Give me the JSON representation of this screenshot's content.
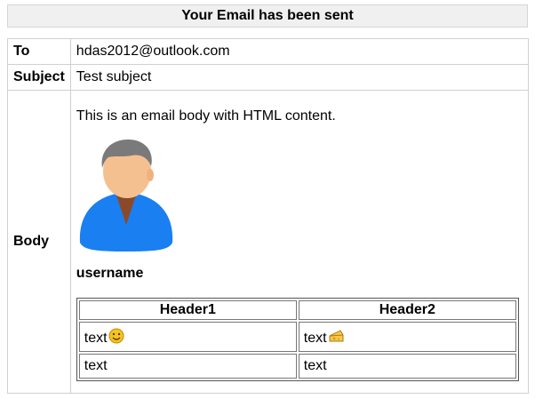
{
  "banner": {
    "title": "Your Email has been sent"
  },
  "email": {
    "to_label": "To",
    "to_value": "hdas2012@outlook.com",
    "subject_label": "Subject",
    "subject_value": "Test subject",
    "body_label": "Body",
    "body_intro": "This is an email body with HTML content.",
    "username": "username",
    "avatar_icon": "user-avatar-icon",
    "colors": {
      "avatar_hair": "#7a7a7a",
      "avatar_face": "#f5c08f",
      "avatar_shirt": "#1a7ff0",
      "avatar_collar": "#8a4a2a"
    }
  },
  "table": {
    "headers": [
      "Header1",
      "Header2"
    ],
    "rows": [
      [
        "text",
        "text"
      ],
      [
        "text",
        "text"
      ]
    ],
    "icons": [
      "smiley-face-icon",
      "cheese-icon"
    ]
  }
}
